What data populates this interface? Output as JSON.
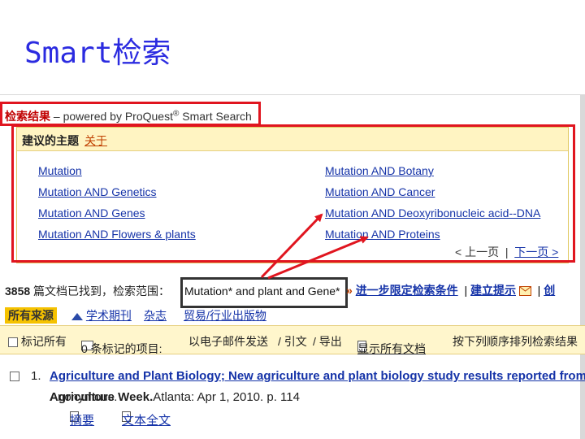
{
  "slide": {
    "title": "Smart检索"
  },
  "results_header": {
    "label": "检索结果",
    "powered_by": "– powered by ProQuest",
    "registered": "®",
    "smart_search": "Smart Search"
  },
  "suggestions": {
    "heading": "建议的主题",
    "about": "关于",
    "left_terms": [
      "Mutation",
      "Mutation AND Genetics",
      "Mutation AND Genes",
      "Mutation AND Flowers & plants"
    ],
    "right_terms": [
      "Mutation AND Botany",
      "Mutation AND Cancer",
      "Mutation AND Deoxyribonucleic acid--DNA",
      "Mutation AND Proteins"
    ],
    "prev": "< 上一页",
    "sep": "|",
    "next": "下一页 >"
  },
  "found": {
    "count": "3858",
    "text": "篇文档已找到，检索范围：",
    "query": "Mutation* and plant and Gene*",
    "arrow": "»",
    "refine": "进一步限定检索条件",
    "sep": "|",
    "alert": "建立提示",
    "more": "创"
  },
  "tabs": [
    "所有来源",
    "学术期刊",
    "杂志",
    "贸易/行业出版物"
  ],
  "toolbar": {
    "mark_all": "标记所有",
    "marked": "0 条标记的项目:",
    "email": "以电子邮件发送",
    "cite": "/ 引文",
    "export": "/ 导出",
    "show_all": "显示所有文档",
    "sort": "按下列顺序排列检索结果"
  },
  "result1": {
    "number": "1.",
    "title": "Agriculture and Plant Biology; New agriculture and plant biology study results reported from U",
    "author": "Anonymous.",
    "source": "Agriculture Week.",
    "details": "Atlanta: Apr 1, 2010. p. 114",
    "abstract": "摘要",
    "fulltext": "文本全文"
  },
  "colors": {
    "title_blue": "#2b2be0",
    "red_box": "#e0151f",
    "link": "#1533a8",
    "tab_active": "#f5c200",
    "toolbar_bg": "#fff6cc"
  }
}
